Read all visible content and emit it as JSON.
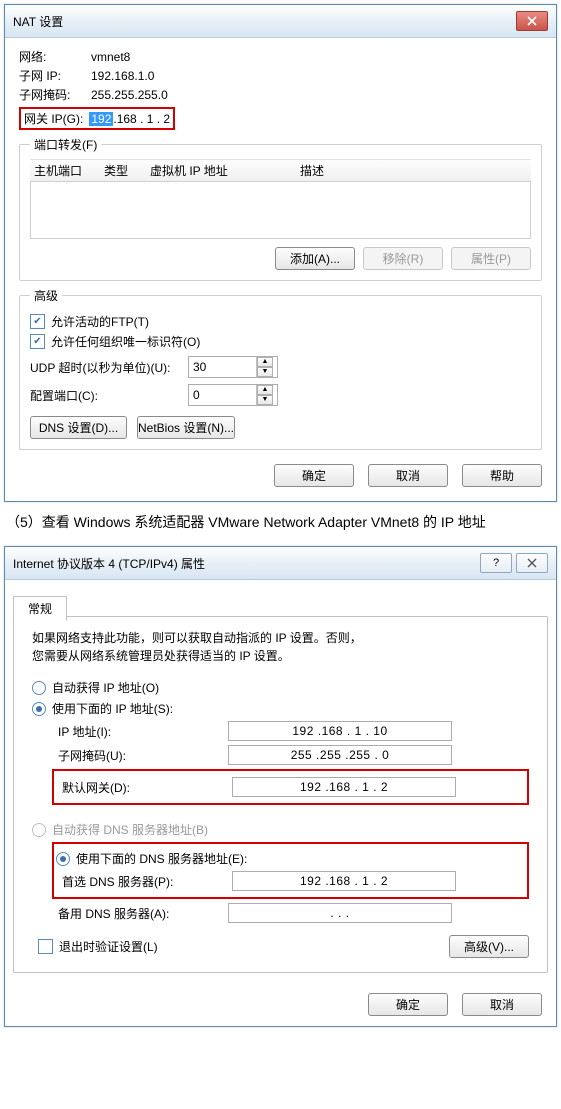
{
  "nat": {
    "title": "NAT 设置",
    "network_label": "网络:",
    "network_value": "vmnet8",
    "subnet_ip_label": "子网 IP:",
    "subnet_ip_value": "192.168.1.0",
    "subnet_mask_label": "子网掩码:",
    "subnet_mask_value": "255.255.255.0",
    "gateway_label": "网关 IP(G):",
    "gateway_oct1": "192",
    "gateway_rest": ".168 . 1 . 2",
    "portfwd": {
      "legend": "端口转发(F)",
      "col_hostport": "主机端口",
      "col_type": "类型",
      "col_vmip": "虚拟机 IP 地址",
      "col_desc": "描述",
      "add": "添加(A)...",
      "remove": "移除(R)",
      "props": "属性(P)"
    },
    "advanced": {
      "legend": "高级",
      "allow_ftp": "允许活动的FTP(T)",
      "allow_org": "允许任何组织唯一标识符(O)",
      "udp_timeout_label": "UDP 超时(以秒为单位)(U):",
      "udp_timeout_value": "30",
      "config_port_label": "配置端口(C):",
      "config_port_value": "0",
      "dns_btn": "DNS 设置(D)...",
      "netbios_btn": "NetBios 设置(N)..."
    },
    "ok": "确定",
    "cancel": "取消",
    "help": "帮助"
  },
  "doc_line": "（5）查看 Windows 系统适配器 VMware Network Adapter VMnet8 的 IP 地址",
  "ipv4": {
    "title": "Internet 协议版本 4 (TCP/IPv4) 属性",
    "tab": "常规",
    "para1": "如果网络支持此功能，则可以获取自动指派的 IP 设置。否则，",
    "para2": "您需要从网络系统管理员处获得适当的 IP 设置。",
    "auto_ip": "自动获得 IP 地址(O)",
    "use_ip": "使用下面的 IP 地址(S):",
    "ip_label": "IP 地址(I):",
    "ip_value": "192 .168 . 1 . 10",
    "mask_label": "子网掩码(U):",
    "mask_value": "255 .255 .255 . 0",
    "gw_label": "默认网关(D):",
    "gw_value": "192 .168 . 1 . 2",
    "auto_dns": "自动获得 DNS 服务器地址(B)",
    "use_dns": "使用下面的 DNS 服务器地址(E):",
    "pref_dns_label": "首选 DNS 服务器(P):",
    "pref_dns_value": "192 .168 . 1 . 2",
    "alt_dns_label": "备用 DNS 服务器(A):",
    "alt_dns_value": " . . . ",
    "validate": "退出时验证设置(L)",
    "adv": "高级(V)...",
    "ok": "确定",
    "cancel": "取消"
  }
}
